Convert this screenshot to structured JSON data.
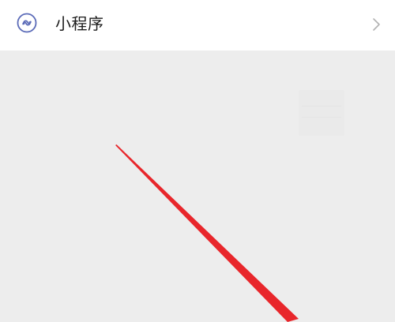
{
  "row": {
    "icon": "mini-program-icon",
    "label": "小程序",
    "chevron_icon": "chevron-right-icon"
  },
  "colors": {
    "header_bg": "#ffffff",
    "content_bg": "#ededed",
    "icon_color": "#5b6bb8",
    "annotation_arrow": "#e8262b",
    "chevron": "#b2b2b2"
  },
  "annotation": {
    "type": "arrow-line",
    "color": "#e8262b"
  }
}
